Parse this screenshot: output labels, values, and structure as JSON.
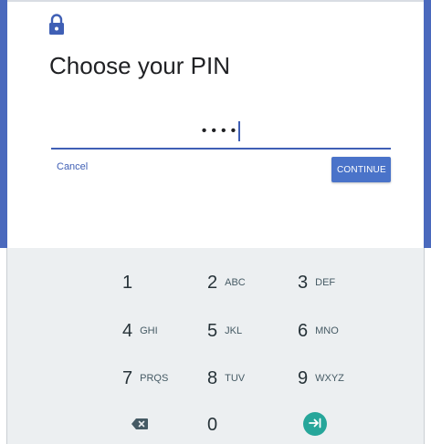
{
  "dialog": {
    "title": "Choose your PIN",
    "pin_value": "••••",
    "cancel_label": "Cancel",
    "continue_label": "CONTINUE"
  },
  "icons": {
    "lock": "lock-icon",
    "backspace": "backspace-icon",
    "enter": "enter-arrow-icon"
  },
  "keypad": {
    "keys": [
      {
        "digit": "1",
        "letters": ""
      },
      {
        "digit": "2",
        "letters": "ABC"
      },
      {
        "digit": "3",
        "letters": "DEF"
      },
      {
        "digit": "4",
        "letters": "GHI"
      },
      {
        "digit": "5",
        "letters": "JKL"
      },
      {
        "digit": "6",
        "letters": "MNO"
      },
      {
        "digit": "7",
        "letters": "PRQS"
      },
      {
        "digit": "8",
        "letters": "TUV"
      },
      {
        "digit": "9",
        "letters": "WXYZ"
      },
      {
        "digit": "0",
        "letters": ""
      }
    ]
  },
  "colors": {
    "accent": "#4a69bd",
    "continue_bg": "#4a73c9",
    "enter_bg": "#26a69a",
    "keypad_bg": "#eceff1"
  }
}
